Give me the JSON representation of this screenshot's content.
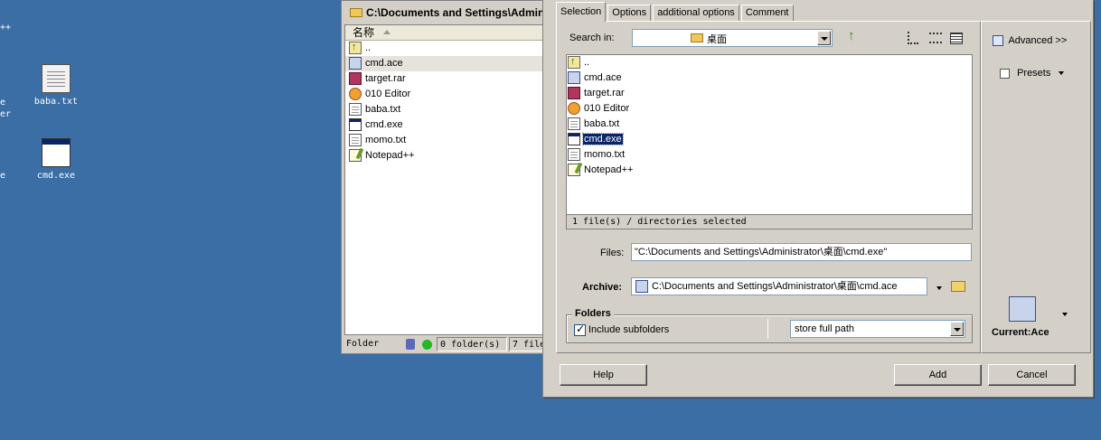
{
  "desktop": {
    "icons": [
      {
        "label": "baba.txt"
      },
      {
        "label": "cmd.exe"
      }
    ],
    "fragments": [
      "++",
      "e",
      "er",
      "e"
    ]
  },
  "file_manager": {
    "title": "C:\\Documents and Settings\\Admin",
    "column_name": "名称",
    "rows": [
      {
        "name": ".."
      },
      {
        "name": "cmd.ace"
      },
      {
        "name": "target.rar"
      },
      {
        "name": "010 Editor"
      },
      {
        "name": "baba.txt"
      },
      {
        "name": "cmd.exe"
      },
      {
        "name": "momo.txt"
      },
      {
        "name": "Notepad++"
      }
    ],
    "status": {
      "left": "Folder",
      "folders": "0 folder(s)",
      "files": "7 file"
    }
  },
  "dialog": {
    "tabs": [
      {
        "label": "Selection"
      },
      {
        "label": "Options"
      },
      {
        "label": "additional options"
      },
      {
        "label": "Comment"
      }
    ],
    "search_in": {
      "label": "Search in:",
      "value": "桌面"
    },
    "files_list": [
      {
        "name": ".."
      },
      {
        "name": "cmd.ace"
      },
      {
        "name": "target.rar"
      },
      {
        "name": "010 Editor"
      },
      {
        "name": "baba.txt"
      },
      {
        "name": "cmd.exe"
      },
      {
        "name": "momo.txt"
      },
      {
        "name": "Notepad++"
      }
    ],
    "selection_status": "1 file(s) / directories selected",
    "files_field": {
      "label": "Files:",
      "value": "\"C:\\Documents and Settings\\Administrator\\桌面\\cmd.exe\""
    },
    "archive_field": {
      "label": "Archive:",
      "value": "C:\\Documents and Settings\\Administrator\\桌面\\cmd.ace"
    },
    "folders_group": {
      "title": "Folders",
      "include_subfolders": "Include subfolders",
      "include_subfolders_checked": true,
      "path_mode": "store full path"
    },
    "right": {
      "advanced": "Advanced >>",
      "presets": "Presets",
      "format": "Current:Ace"
    },
    "buttons": {
      "help": "Help",
      "add": "Add",
      "cancel": "Cancel"
    }
  }
}
